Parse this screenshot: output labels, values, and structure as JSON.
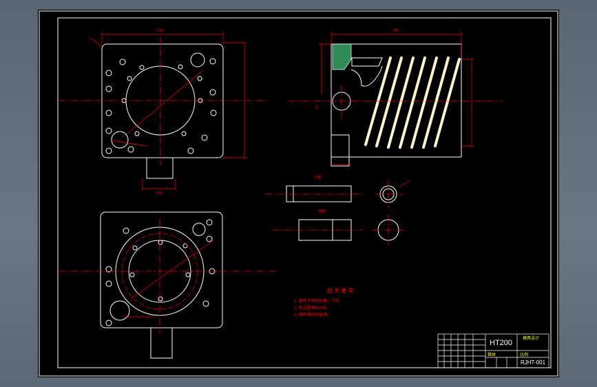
{
  "drawing": {
    "material": "HT200",
    "drawing_number": "RJHT-001",
    "company_label": "模具设计",
    "part_name_label": "箱体",
    "scale_label": "比例",
    "technical_requirements": {
      "title": "技 术 要 求",
      "items": [
        "1. 铸件不得有砂眼、气孔",
        "2. 未注圆角R3-R5",
        "3. 铸件需时效处理"
      ]
    },
    "view_labels": {
      "section_a": "A-A",
      "bore_label": "孔",
      "part_label_1": "衬套",
      "part_label_2": "轴套",
      "detail_label": "B向"
    },
    "dimensions": {
      "top_width": "200",
      "right_width": "180",
      "height_right": "160",
      "height_left": "190"
    }
  },
  "colors": {
    "background": "#000000",
    "frame": "#ffffff",
    "centerline": "#ff0000",
    "dimension": "#ff0000",
    "outline": "#ffffff",
    "thread": "#fff5cc",
    "hatch": "#2e8b57",
    "titleblock_text": "#ffff00"
  }
}
